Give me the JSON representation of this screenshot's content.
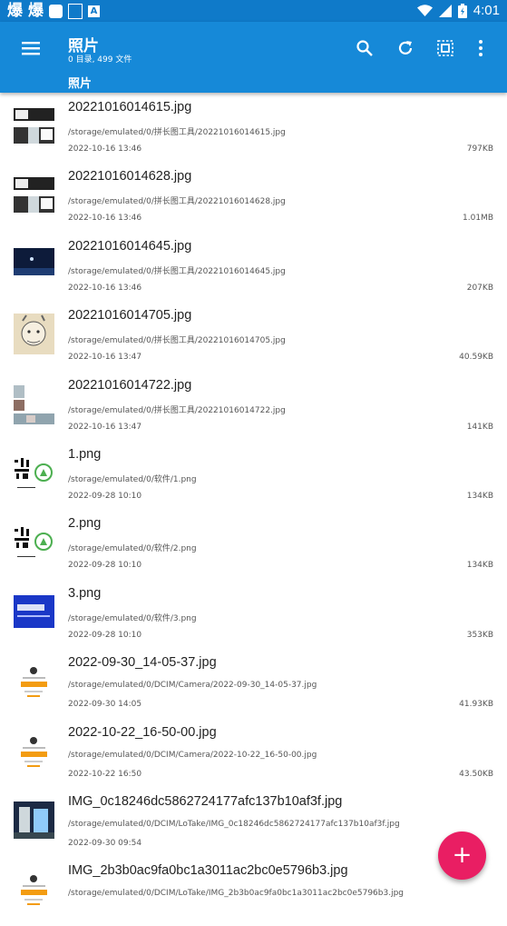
{
  "status_bar": {
    "left_glyphs": [
      "爆",
      "爆"
    ],
    "time": "4:01",
    "icons": [
      "wifi-icon",
      "signal-icon",
      "battery-icon"
    ]
  },
  "app_bar": {
    "title": "照片",
    "subtitle": "0 目录, 499 文件",
    "breadcrumb": "照片",
    "actions": [
      "menu-icon",
      "search-icon",
      "refresh-icon",
      "select-all-icon",
      "more-vert-icon"
    ]
  },
  "colors": {
    "app_bar": "#1689d8",
    "status_bar": "#0f7ac9",
    "fab": "#e91e63"
  },
  "files": [
    {
      "name": "20221016014615.jpg",
      "path": "/storage/emulated/0/拼长图工具/20221016014615.jpg",
      "date": "2022-10-16 13:46",
      "size": "797KB",
      "thumb": "manga"
    },
    {
      "name": "20221016014628.jpg",
      "path": "/storage/emulated/0/拼长图工具/20221016014628.jpg",
      "date": "2022-10-16 13:46",
      "size": "1.01MB",
      "thumb": "manga"
    },
    {
      "name": "20221016014645.jpg",
      "path": "/storage/emulated/0/拼长图工具/20221016014645.jpg",
      "date": "2022-10-16 13:46",
      "size": "207KB",
      "thumb": "night"
    },
    {
      "name": "20221016014705.jpg",
      "path": "/storage/emulated/0/拼长图工具/20221016014705.jpg",
      "date": "2022-10-16 13:47",
      "size": "40.59KB",
      "thumb": "face"
    },
    {
      "name": "20221016014722.jpg",
      "path": "/storage/emulated/0/拼长图工具/20221016014722.jpg",
      "date": "2022-10-16 13:47",
      "size": "141KB",
      "thumb": "strip"
    },
    {
      "name": "1.png",
      "path": "/storage/emulated/0/软件/1.png",
      "date": "2022-09-28 10:10",
      "size": "134KB",
      "thumb": "qr"
    },
    {
      "name": "2.png",
      "path": "/storage/emulated/0/软件/2.png",
      "date": "2022-09-28 10:10",
      "size": "134KB",
      "thumb": "qr"
    },
    {
      "name": "3.png",
      "path": "/storage/emulated/0/软件/3.png",
      "date": "2022-09-28 10:10",
      "size": "353KB",
      "thumb": "blue"
    },
    {
      "name": "2022-09-30_14-05-37.jpg",
      "path": "/storage/emulated/0/DCIM/Camera/2022-09-30_14-05-37.jpg",
      "date": "2022-09-30 14:05",
      "size": "41.93KB",
      "thumb": "card"
    },
    {
      "name": "2022-10-22_16-50-00.jpg",
      "path": "/storage/emulated/0/DCIM/Camera/2022-10-22_16-50-00.jpg",
      "date": "2022-10-22 16:50",
      "size": "43.50KB",
      "thumb": "card"
    },
    {
      "name": "IMG_0c18246dc5862724177afc137b10af3f.jpg",
      "path": "/storage/emulated/0/DCIM/LoTake/IMG_0c18246dc5862724177afc137b10af3f.jpg",
      "date": "2022-09-30 09:54",
      "size": "",
      "thumb": "anime"
    },
    {
      "name": "IMG_2b3b0ac9fa0bc1a3011ac2bc0e5796b3.jpg",
      "path": "/storage/emulated/0/DCIM/LoTake/IMG_2b3b0ac9fa0bc1a3011ac2bc0e5796b3.jpg",
      "date": "",
      "size": "",
      "thumb": "card"
    }
  ],
  "fab": {
    "label": "+"
  }
}
